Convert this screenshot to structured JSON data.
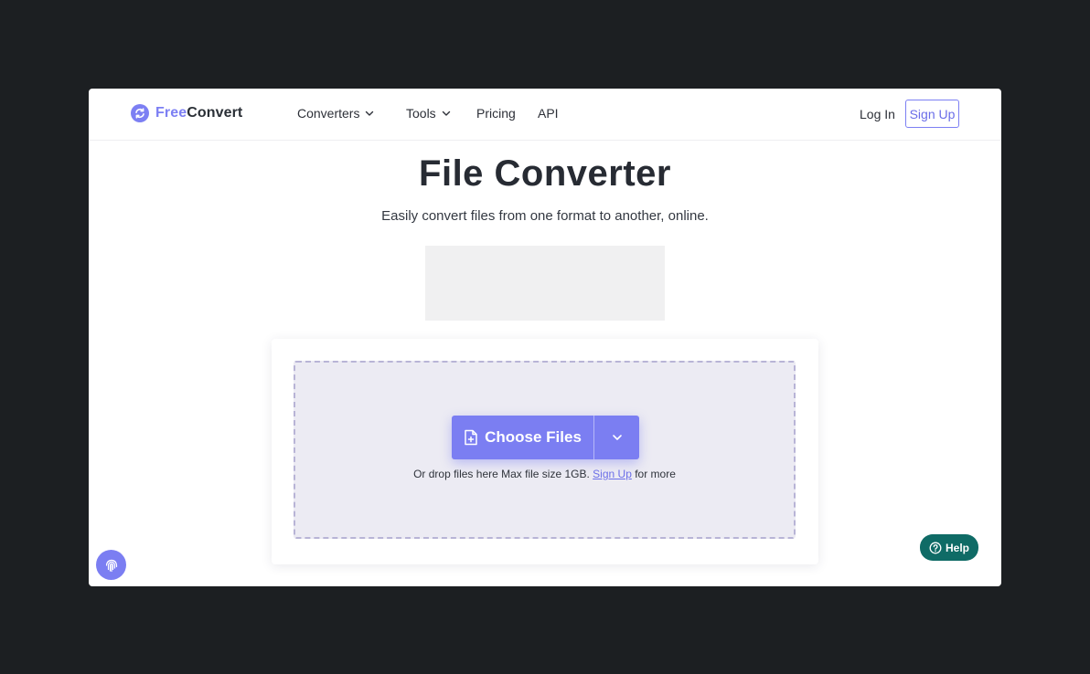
{
  "brand": {
    "name_part1": "Free",
    "name_part2": "Convert",
    "accent_color": "#7c7ff3"
  },
  "nav": {
    "items": [
      {
        "label": "Converters",
        "has_dropdown": true
      },
      {
        "label": "Tools",
        "has_dropdown": true
      },
      {
        "label": "Pricing",
        "has_dropdown": false
      },
      {
        "label": "API",
        "has_dropdown": false
      }
    ],
    "login_label": "Log In",
    "signup_label": "Sign Up"
  },
  "hero": {
    "title": "File Converter",
    "subtitle": "Easily convert files from one format to another, online."
  },
  "upload": {
    "choose_label": "Choose Files",
    "hint_prefix": "Or drop files here Max file size 1GB.",
    "hint_link": "Sign Up",
    "hint_suffix": "for more"
  },
  "help": {
    "label": "Help",
    "color": "#0f6b66"
  },
  "icons": {
    "logo": "refresh-circle-icon",
    "file_add": "file-plus-icon",
    "chevron": "chevron-down-icon",
    "fingerprint": "fingerprint-icon",
    "help": "question-circle-icon"
  }
}
